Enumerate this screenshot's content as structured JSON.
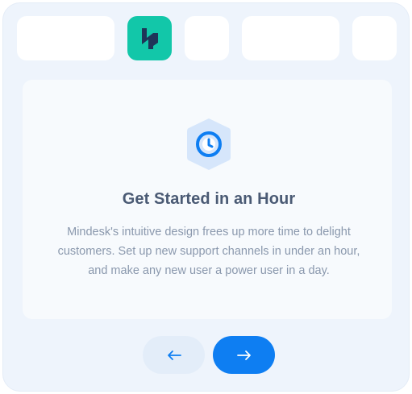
{
  "feature": {
    "title": "Get Started in an Hour",
    "description": "Mindesk's intuitive design frees up more time to delight customers. Set up new support channels in under an hour, and make any new user a power user in a day.",
    "icon": "clock-shield-icon"
  },
  "tabs": [
    {
      "active": false
    },
    {
      "active": true,
      "icon": "brand-logo-icon"
    },
    {
      "active": false
    },
    {
      "active": false
    },
    {
      "active": false
    }
  ],
  "navigation": {
    "prev_icon": "arrow-left-icon",
    "next_icon": "arrow-right-icon"
  },
  "colors": {
    "accent": "#0e7ef2",
    "brand": "#12c7a9",
    "background": "#eef4fc",
    "title": "#4a5a74",
    "text": "#8a98ad"
  }
}
